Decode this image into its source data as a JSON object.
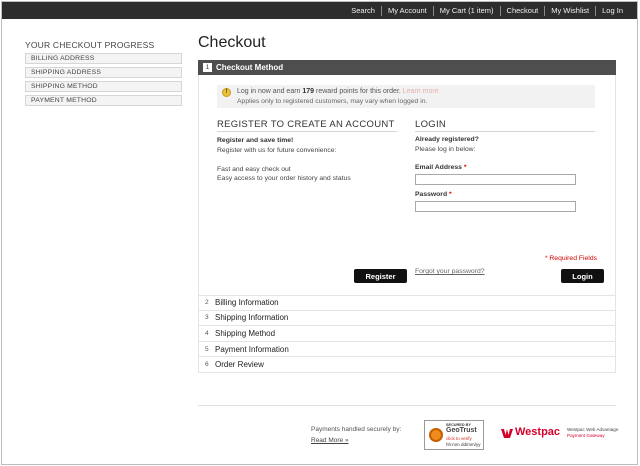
{
  "top_nav": {
    "links": [
      "Search",
      "My Account",
      "My Cart (1 item)",
      "Checkout",
      "My Wishlist",
      "Log In"
    ]
  },
  "progress": {
    "title": "YOUR CHECKOUT PROGRESS",
    "steps": [
      "BILLING ADDRESS",
      "SHIPPING ADDRESS",
      "SHIPPING METHOD",
      "PAYMENT METHOD"
    ]
  },
  "page": {
    "title": "Checkout"
  },
  "active_section": {
    "number": "1",
    "title": "Checkout Method",
    "notice": {
      "line1_prefix": "Log in now and earn ",
      "points": "179",
      "line1_suffix": " reward points for this order.",
      "link": "Learn more",
      "line2": "Applies only to registered customers, may vary when logged in."
    },
    "register": {
      "heading": "REGISTER TO CREATE AN ACCOUNT",
      "subheading": "Register and save time!",
      "intro": "Register with us for future convenience:",
      "benefit1": "Fast and easy check out",
      "benefit2": "Easy access to your order history and status",
      "button": "Register"
    },
    "login": {
      "heading": "LOGIN",
      "already": "Already registered?",
      "prompt": "Please log in below:",
      "email_label": "Email Address",
      "password_label": "Password",
      "required_mark": "*",
      "email_value": "",
      "password_value": "",
      "required_note": "* Required Fields",
      "forgot": "Forgot your password?",
      "button": "Login"
    }
  },
  "sections": [
    {
      "number": "2",
      "title": "Billing Information"
    },
    {
      "number": "3",
      "title": "Shipping Information"
    },
    {
      "number": "4",
      "title": "Shipping Method"
    },
    {
      "number": "5",
      "title": "Payment Information"
    },
    {
      "number": "6",
      "title": "Order Review"
    }
  ],
  "footer": {
    "payments_text": "Payments handled securely by:",
    "read_more": "Read More »",
    "geotrust": {
      "secured_by": "SECURED BY",
      "brand": "GeoTrust",
      "click": "click to verify",
      "date": "hh:mm dd/mm/yy"
    },
    "westpac": {
      "brand": "Westpac",
      "line1": "Westpac Web Advantage",
      "line2": "Payment Gateway"
    }
  },
  "colors": {
    "top_bar": "#2d2d2d",
    "section_header": "#4e4e4e",
    "required": "#d40000",
    "westpac_red": "#d5002b",
    "geotrust_orange": "#f08a1b"
  }
}
